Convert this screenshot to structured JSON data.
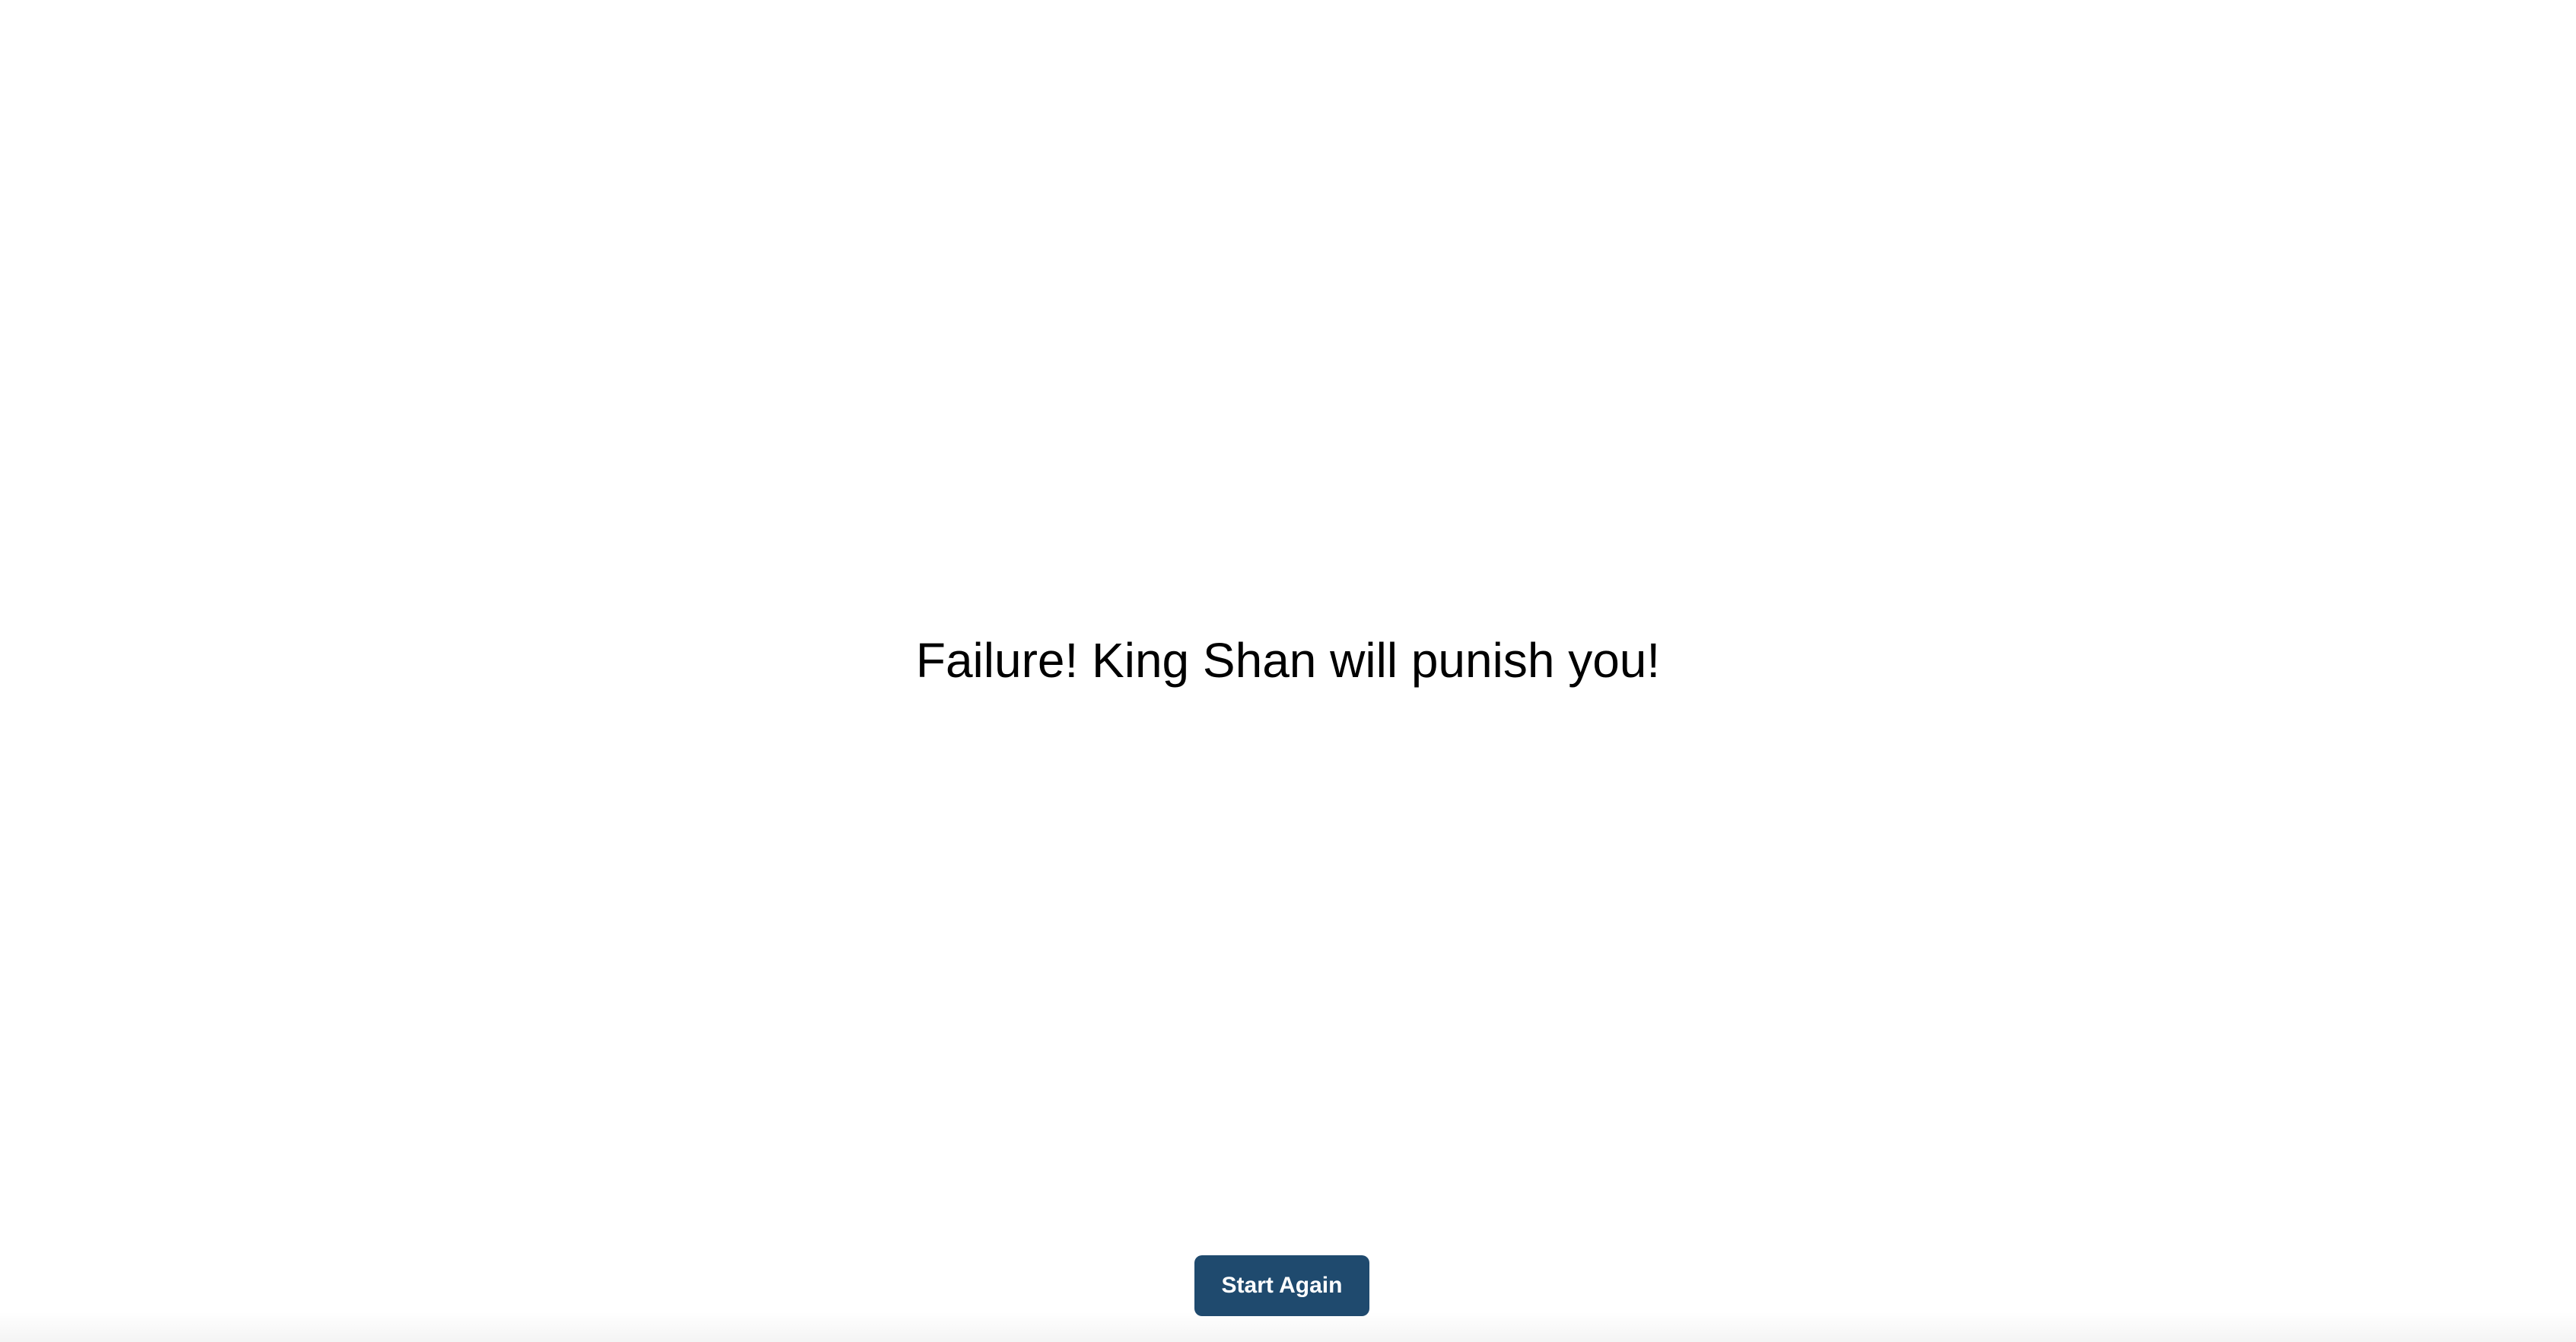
{
  "message": {
    "text": "Failure! King Shan will punish you!"
  },
  "actions": {
    "start_again_label": "Start Again"
  },
  "colors": {
    "background": "#ffffff",
    "text": "#000000",
    "button_background": "#1f4a6e",
    "button_text": "#ffffff"
  }
}
